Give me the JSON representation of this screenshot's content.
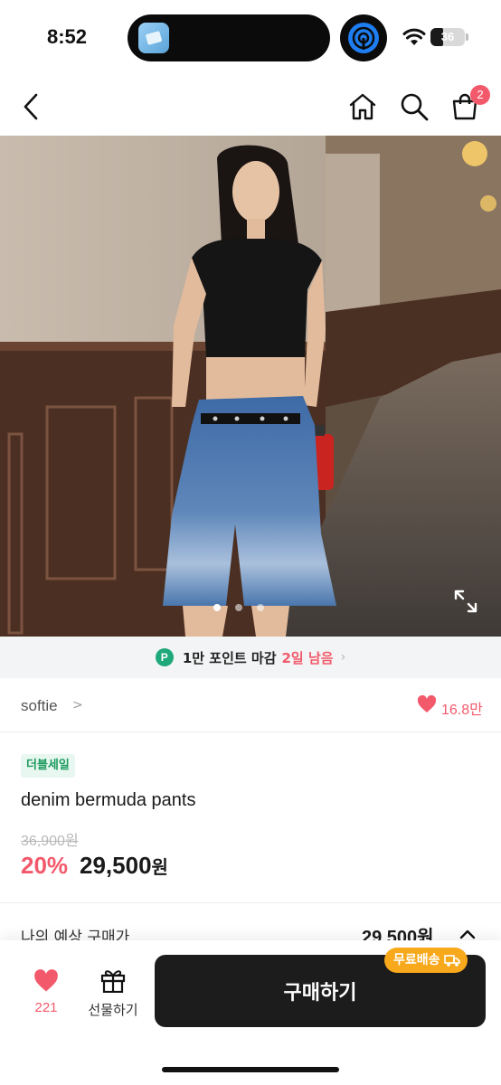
{
  "status_bar": {
    "time": "8:52",
    "battery_level": 36,
    "battery_text": "36"
  },
  "header": {
    "back_icon": "chevron-left-icon",
    "home_icon": "home-icon",
    "search_icon": "search-icon",
    "cart_icon": "shopping-bag-icon",
    "cart_badge": "2"
  },
  "gallery": {
    "image_count": 3,
    "active_index": 0,
    "expand_icon": "expand-icon"
  },
  "point_banner": {
    "badge": "P",
    "text": "1만 포인트 마감",
    "days_left": "2일 남음",
    "chevron": "›"
  },
  "seller": {
    "name": "softie",
    "chevron": ">",
    "likes": "16.8만"
  },
  "product": {
    "badge": "더블세일",
    "title": "denim bermuda pants",
    "original_price": "36,900원",
    "discount": "20%",
    "price_value": "29,500",
    "price_unit": "원"
  },
  "expected": {
    "label": "나의 예상 구매가",
    "price": "29,500원"
  },
  "bottom": {
    "wish_count": "221",
    "gift_label": "선물하기",
    "buy_label": "구매하기",
    "shipping_badge": "무료배송"
  },
  "colors": {
    "accent": "#f25a6b",
    "point_green": "#1fa87a",
    "shipping_orange": "#f7a81b",
    "buy_button": "#1c1c1c"
  }
}
